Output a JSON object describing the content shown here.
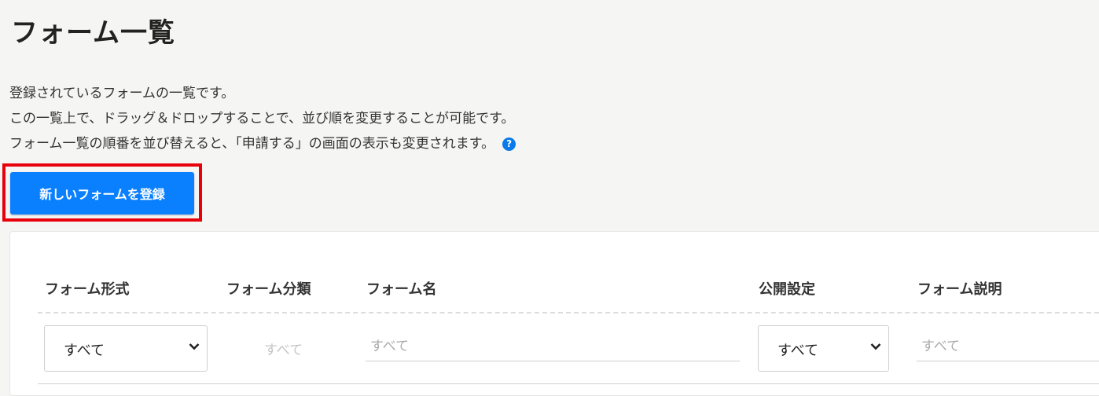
{
  "page": {
    "title": "フォーム一覧",
    "description": [
      "登録されているフォームの一覧です。",
      "この一覧上で、ドラッグ＆ドロップすることで、並び順を変更することが可能です。",
      "フォーム一覧の順番を並び替えると、「申請する」の画面の表示も変更されます。"
    ],
    "help_icon_glyph": "?"
  },
  "actions": {
    "new_form_label": "新しいフォームを登録"
  },
  "table": {
    "headers": [
      "フォーム形式",
      "フォーム分類",
      "フォーム名",
      "公開設定",
      "フォーム説明"
    ],
    "filters": {
      "form_type": {
        "selected": "すべて"
      },
      "form_category": {
        "text": "すべて"
      },
      "form_name": {
        "placeholder": "すべて"
      },
      "visibility": {
        "selected": "すべて"
      },
      "form_description": {
        "placeholder": "すべて"
      }
    }
  },
  "colors": {
    "primary": "#0a80ff",
    "highlight": "#e8000b",
    "help_icon": "#0a7ae8"
  }
}
